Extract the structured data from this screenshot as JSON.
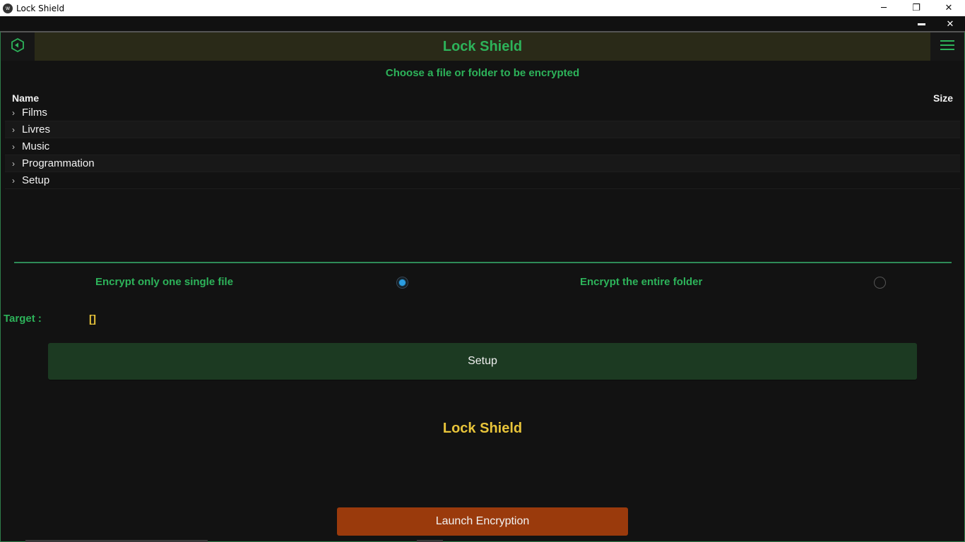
{
  "window": {
    "title": "Lock Shield",
    "minimize_glyph": "─",
    "maximize_glyph": "❐",
    "close_glyph": "✕",
    "app_icon_glyph": "w"
  },
  "subbar": {
    "minimize_glyph": "▬",
    "close_glyph": "✕"
  },
  "topbar": {
    "title": "Lock Shield",
    "back_icon": "back-hexagon-icon",
    "menu_icon": "hamburger-menu-icon"
  },
  "heading": "Choose a file or folder to be encrypted",
  "file_browser": {
    "columns": {
      "name": "Name",
      "size": "Size"
    },
    "rows": [
      {
        "name": "Films"
      },
      {
        "name": "Livres"
      },
      {
        "name": "Music"
      },
      {
        "name": "Programmation"
      },
      {
        "name": "Setup"
      }
    ],
    "chevron_glyph": "›"
  },
  "options": {
    "single_file_label": "Encrypt only one single file",
    "single_file_selected": true,
    "folder_label": "Encrypt the entire folder",
    "folder_selected": false
  },
  "target": {
    "label": "Target :",
    "value": "[]"
  },
  "buttons": {
    "setup": "Setup",
    "launch": "Launch Encryption"
  },
  "brand": "Lock Shield",
  "colors": {
    "accent_green": "#2db35a",
    "accent_yellow": "#e8c43a",
    "launch_orange": "#9a3a0c",
    "setup_green": "#1c3a22",
    "background": "#121212"
  }
}
